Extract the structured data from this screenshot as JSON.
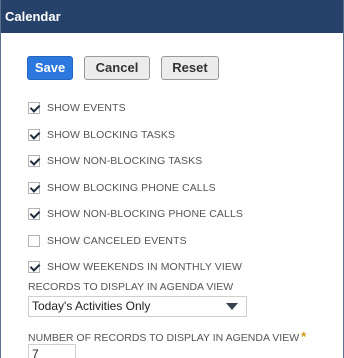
{
  "window": {
    "title": "Calendar"
  },
  "toolbar": {
    "save_label": "Save",
    "cancel_label": "Cancel",
    "reset_label": "Reset"
  },
  "options": [
    {
      "label": "SHOW EVENTS",
      "checked": true
    },
    {
      "label": "SHOW BLOCKING TASKS",
      "checked": true
    },
    {
      "label": "SHOW NON-BLOCKING TASKS",
      "checked": true
    },
    {
      "label": "SHOW BLOCKING PHONE CALLS",
      "checked": true
    },
    {
      "label": "SHOW NON-BLOCKING PHONE CALLS",
      "checked": true
    },
    {
      "label": "SHOW CANCELED EVENTS",
      "checked": false
    },
    {
      "label": "SHOW WEEKENDS IN MONTHLY VIEW",
      "checked": true
    }
  ],
  "agenda": {
    "records_label": "RECORDS TO DISPLAY IN AGENDA VIEW",
    "records_value": "Today's Activities Only",
    "count_label": "NUMBER OF RECORDS TO DISPLAY IN AGENDA VIEW",
    "required_marker": "*",
    "count_value": "7"
  },
  "colors": {
    "titlebar": "#27426a",
    "primary_button": "#2b78de",
    "required": "#d49a18"
  },
  "icons": {
    "checkbox_check": "check-icon",
    "dropdown": "caret-down-icon"
  }
}
